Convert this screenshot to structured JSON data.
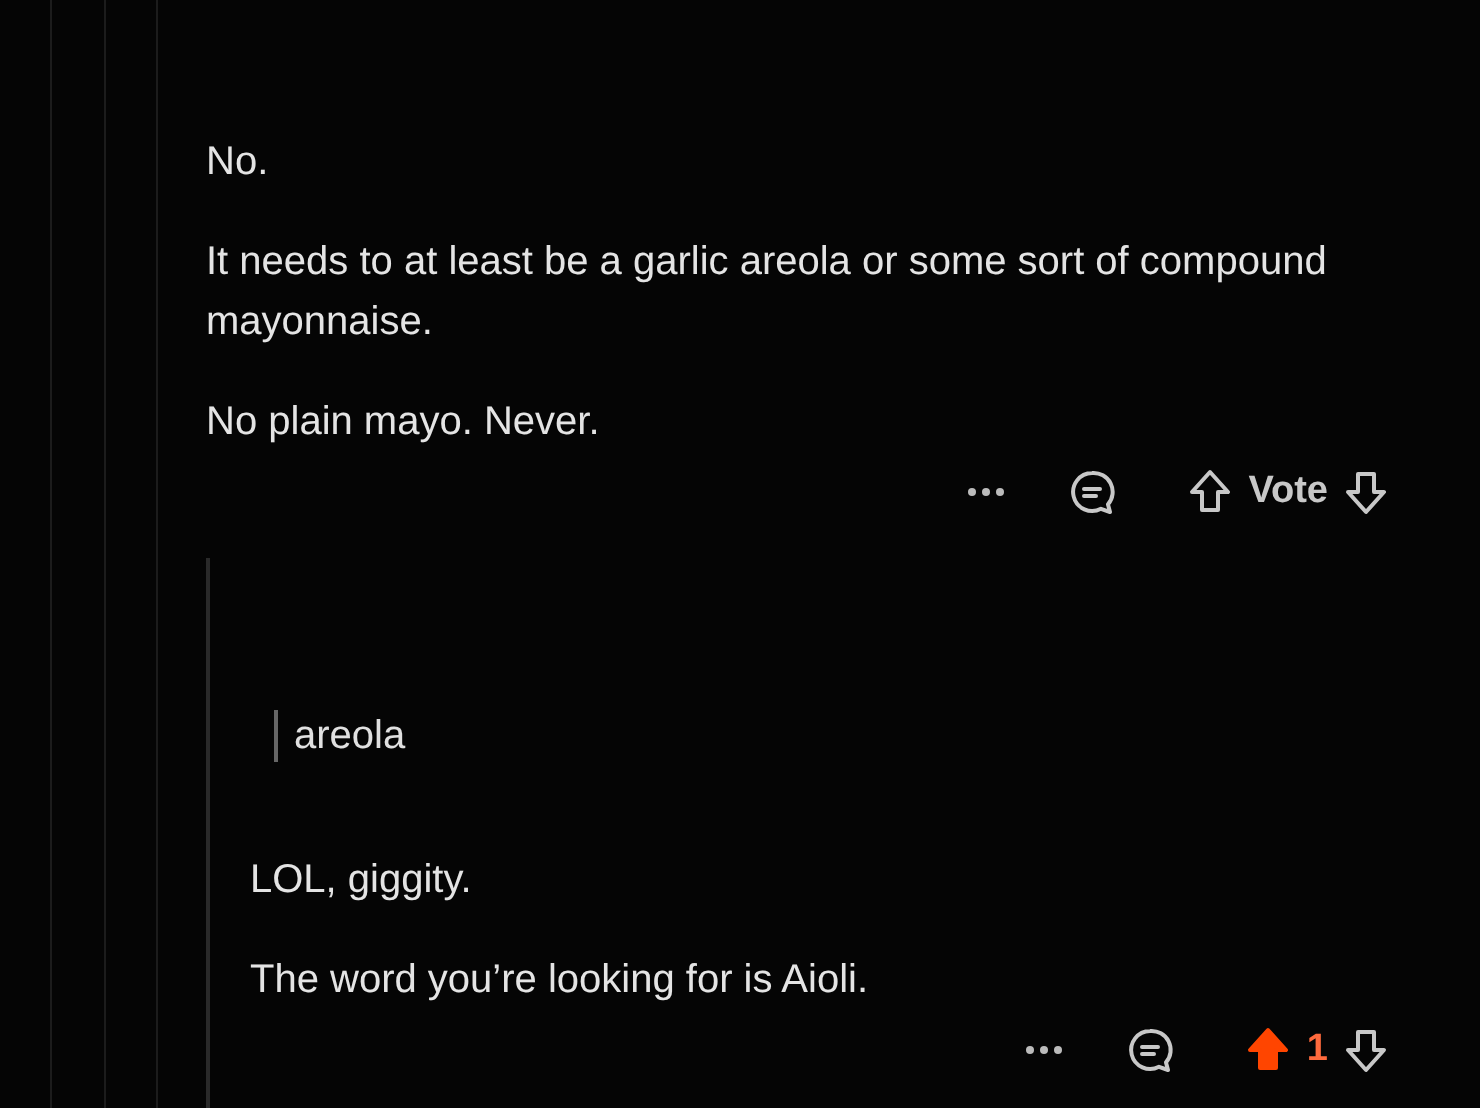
{
  "comments": [
    {
      "paragraphs": [
        "No.",
        "It needs to at least be a garlic areola or some sort of compound mayonnaise.",
        "No plain mayo. Never."
      ],
      "vote": {
        "label": "Vote",
        "upvoted": false
      }
    },
    {
      "quote": "areola",
      "paragraphs": [
        "LOL, giggity.",
        "The word you’re looking for is Aioli."
      ],
      "vote": {
        "label": "1",
        "upvoted": true
      }
    }
  ]
}
